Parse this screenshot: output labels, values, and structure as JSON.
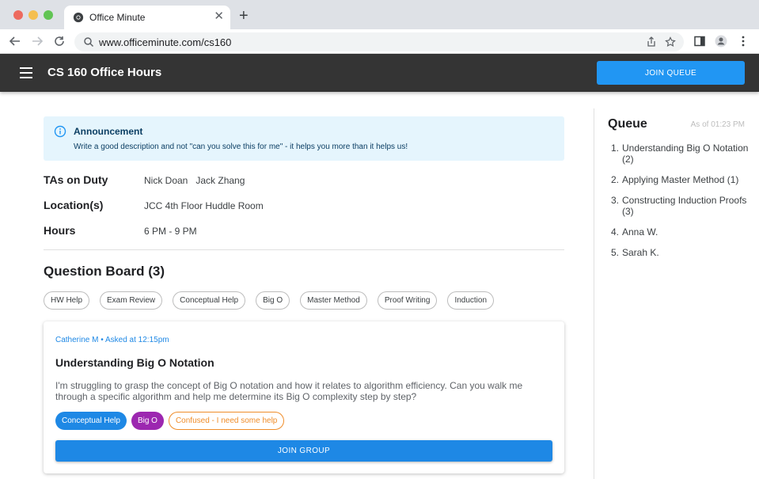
{
  "browser": {
    "tab_title": "Office Minute",
    "url": "www.officeminute.com/cs160"
  },
  "header": {
    "title": "CS 160 Office Hours",
    "join_queue_label": "JOIN QUEUE"
  },
  "announcement": {
    "title": "Announcement",
    "text": "Write a good description and not \"can you solve this for me\" - it helps you more than it helps us!"
  },
  "info": {
    "tas_label": "TAs on Duty",
    "tas_value": "Nick Doan   Jack Zhang",
    "location_label": "Location(s)",
    "location_value": "JCC 4th Floor Huddle Room",
    "hours_label": "Hours",
    "hours_value": "6 PM - 9 PM"
  },
  "board": {
    "title": "Question Board (3)",
    "filters": [
      "HW Help",
      "Exam Review",
      "Conceptual Help",
      "Big O",
      "Master Method",
      "Proof Writing",
      "Induction"
    ]
  },
  "card": {
    "meta": "Catherine M • Asked at 12:15pm",
    "title": "Understanding Big O Notation",
    "description": "I'm struggling to grasp the concept of Big O notation and how it relates to algorithm efficiency. Can you walk me through a specific algorithm and help me determine its Big O complexity step by step?",
    "tags": [
      "Conceptual Help",
      "Big O",
      "Confused - I need some help"
    ],
    "join_label": "JOIN GROUP"
  },
  "queue": {
    "title": "Queue",
    "time": "As of 01:23 PM",
    "items": [
      {
        "num": "1.",
        "text": "Understanding Big O Notation (2)"
      },
      {
        "num": "2.",
        "text": "Applying Master Method (1)"
      },
      {
        "num": "3.",
        "text": "Constructing Induction Proofs (3)"
      },
      {
        "num": "4.",
        "text": "Anna W."
      },
      {
        "num": "5.",
        "text": "Sarah K."
      }
    ]
  },
  "colors": {
    "appbar": "#343434",
    "primary": "#2196f3",
    "tag_purple": "#9c27b0",
    "tag_orange": "#ef8d2a",
    "announcement_bg": "#e5f5fd"
  }
}
